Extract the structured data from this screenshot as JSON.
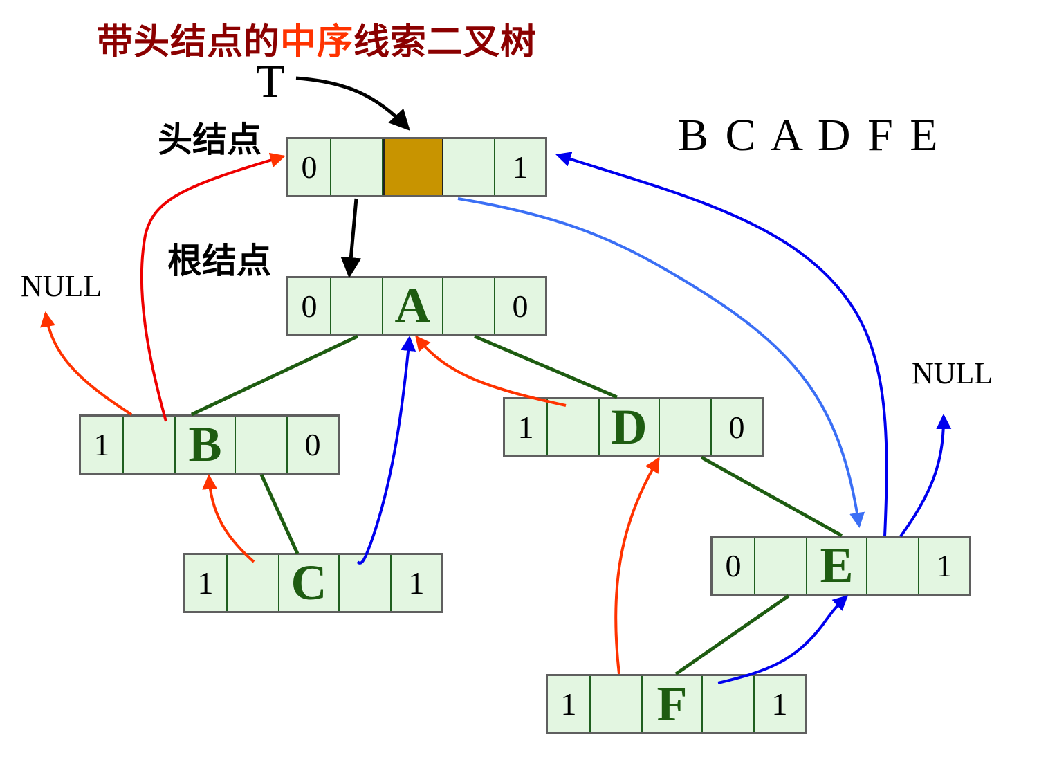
{
  "title": {
    "part1": "带头结点的",
    "part2": "中序",
    "part3": "线索二叉树"
  },
  "pointer_label": "T",
  "head_label": "头结点",
  "root_label": "根结点",
  "inorder_sequence": "B C A D F E",
  "null_left": "NULL",
  "null_right": "NULL",
  "nodes": {
    "head": {
      "ltag": "0",
      "data": "",
      "rtag": "1"
    },
    "A": {
      "ltag": "0",
      "data": "A",
      "rtag": "0"
    },
    "B": {
      "ltag": "1",
      "data": "B",
      "rtag": "0"
    },
    "C": {
      "ltag": "1",
      "data": "C",
      "rtag": "1"
    },
    "D": {
      "ltag": "1",
      "data": "D",
      "rtag": "0"
    },
    "E": {
      "ltag": "0",
      "data": "E",
      "rtag": "1"
    },
    "F": {
      "ltag": "1",
      "data": "F",
      "rtag": "1"
    }
  },
  "colors": {
    "child_link": "#1e5c11",
    "pred_thread": "#ff3300",
    "succ_thread": "#0000ee",
    "head_succ_thread": "#3b6ff5",
    "pointer": "#000000",
    "head_data_fill": "#c89400",
    "node_fill": "#e3f6e1"
  }
}
